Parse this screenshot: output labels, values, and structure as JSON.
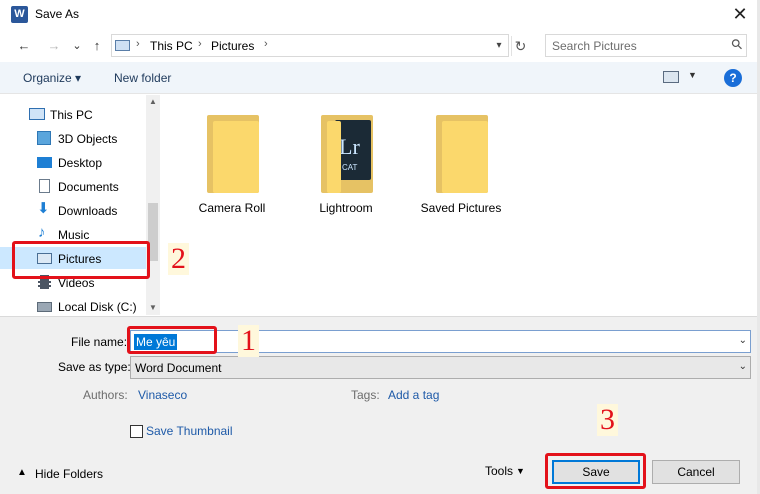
{
  "window": {
    "title": "Save As",
    "app_icon_letter": "W",
    "close_glyph": "✕"
  },
  "navigation": {
    "back_glyph": "←",
    "forward_glyph": "→",
    "recent_glyph": "⌄",
    "up_glyph": "↑",
    "breadcrumb": [
      "This PC",
      "Pictures"
    ],
    "refresh_glyph": "↻",
    "search_placeholder": "Search Pictures"
  },
  "toolbar": {
    "organize_label": "Organize ▾",
    "new_folder_label": "New folder",
    "help_label": "?"
  },
  "sidebar": {
    "items": [
      {
        "label": "This PC",
        "icon": "pc-icon"
      },
      {
        "label": "3D Objects",
        "icon": "cube-icon"
      },
      {
        "label": "Desktop",
        "icon": "desktop-icon"
      },
      {
        "label": "Documents",
        "icon": "document-icon"
      },
      {
        "label": "Downloads",
        "icon": "download-icon"
      },
      {
        "label": "Music",
        "icon": "music-icon"
      },
      {
        "label": "Pictures",
        "icon": "pictures-icon",
        "selected": true
      },
      {
        "label": "Videos",
        "icon": "video-icon"
      },
      {
        "label": "Local Disk (C:)",
        "icon": "disk-icon"
      }
    ]
  },
  "folders": [
    {
      "label": "Camera Roll"
    },
    {
      "label": "Lightroom",
      "badge_text": "Lr",
      "badge_sub": "CAT"
    },
    {
      "label": "Saved Pictures"
    }
  ],
  "form": {
    "file_name_label": "File name:",
    "file_name_value": "Me yêu",
    "save_as_type_label": "Save as type:",
    "save_as_type_value": "Word Document",
    "authors_label": "Authors:",
    "authors_value": "Vinaseco",
    "tags_label": "Tags:",
    "tags_value": "Add a tag",
    "save_thumbnail_label": "Save Thumbnail"
  },
  "footer": {
    "hide_folders_label": "Hide Folders",
    "tools_label": "Tools",
    "save_label": "Save",
    "cancel_label": "Cancel"
  },
  "annotations": {
    "step1": "1",
    "step2": "2",
    "step3": "3",
    "color": "#e3111a"
  }
}
